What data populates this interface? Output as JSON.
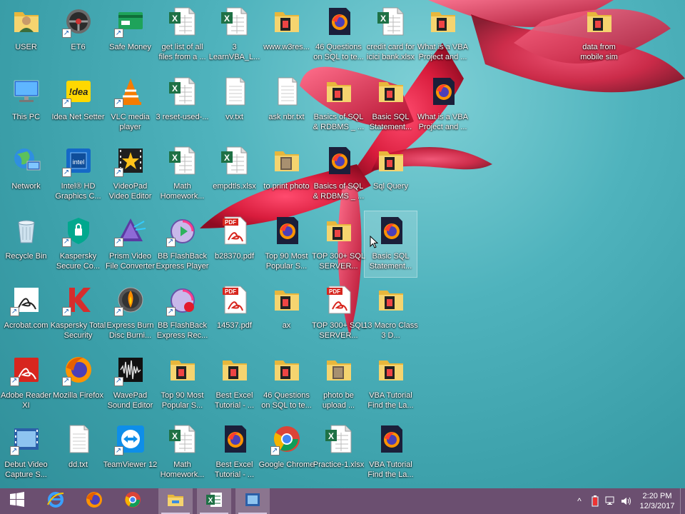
{
  "desktop": {
    "icons": [
      {
        "label": "USER",
        "type": "user",
        "shortcut": false,
        "col": 0,
        "row": 0
      },
      {
        "label": "This PC",
        "type": "pc",
        "shortcut": false,
        "col": 0,
        "row": 1
      },
      {
        "label": "Network",
        "type": "network",
        "shortcut": false,
        "col": 0,
        "row": 2
      },
      {
        "label": "Recycle Bin",
        "type": "recycle",
        "shortcut": false,
        "col": 0,
        "row": 3
      },
      {
        "label": "Acrobat.com",
        "type": "acrobat",
        "shortcut": true,
        "col": 0,
        "row": 4
      },
      {
        "label": "Adobe Reader XI",
        "type": "adobe",
        "shortcut": true,
        "col": 0,
        "row": 5
      },
      {
        "label": "Debut Video Capture S...",
        "type": "video",
        "shortcut": true,
        "col": 0,
        "row": 6
      },
      {
        "label": "ET6",
        "type": "et6",
        "shortcut": true,
        "col": 1,
        "row": 0
      },
      {
        "label": "Idea Net Setter",
        "type": "idea",
        "shortcut": true,
        "col": 1,
        "row": 1
      },
      {
        "label": "Intel® HD Graphics C...",
        "type": "intel",
        "shortcut": true,
        "col": 1,
        "row": 2
      },
      {
        "label": "Kaspersky Secure Co...",
        "type": "kaspersky-shield",
        "shortcut": true,
        "col": 1,
        "row": 3
      },
      {
        "label": "Kaspersky Total Security",
        "type": "kaspersky",
        "shortcut": true,
        "col": 1,
        "row": 4
      },
      {
        "label": "Mozilla Firefox",
        "type": "firefox",
        "shortcut": true,
        "col": 1,
        "row": 5
      },
      {
        "label": "dd.txt",
        "type": "txt",
        "shortcut": false,
        "col": 1,
        "row": 6
      },
      {
        "label": "Safe Money",
        "type": "safemoney",
        "shortcut": true,
        "col": 2,
        "row": 0
      },
      {
        "label": "VLC media player",
        "type": "vlc",
        "shortcut": true,
        "col": 2,
        "row": 1
      },
      {
        "label": "VideoPad Video Editor",
        "type": "videopad",
        "shortcut": true,
        "col": 2,
        "row": 2
      },
      {
        "label": "Prism Video File Converter",
        "type": "prism",
        "shortcut": true,
        "col": 2,
        "row": 3
      },
      {
        "label": "Express Burn Disc Burni...",
        "type": "burn",
        "shortcut": true,
        "col": 2,
        "row": 4
      },
      {
        "label": "WavePad Sound Editor",
        "type": "wavepad",
        "shortcut": true,
        "col": 2,
        "row": 5
      },
      {
        "label": "TeamViewer 12",
        "type": "teamviewer",
        "shortcut": true,
        "col": 2,
        "row": 6
      },
      {
        "label": "get list of all files from a ...",
        "type": "excel",
        "shortcut": false,
        "col": 3,
        "row": 0
      },
      {
        "label": "3 reset-used-...",
        "type": "excel",
        "shortcut": false,
        "col": 3,
        "row": 1
      },
      {
        "label": "Math Homework...",
        "type": "excel",
        "shortcut": false,
        "col": 3,
        "row": 2
      },
      {
        "label": "BB FlashBack Express Player",
        "type": "flashback",
        "shortcut": true,
        "col": 3,
        "row": 3
      },
      {
        "label": "BB FlashBack Express Rec...",
        "type": "flashback-rec",
        "shortcut": true,
        "col": 3,
        "row": 4
      },
      {
        "label": "Top 90 Most Popular S...",
        "type": "folder",
        "shortcut": false,
        "col": 3,
        "row": 5
      },
      {
        "label": "Math Homework...",
        "type": "excel",
        "shortcut": false,
        "col": 3,
        "row": 6
      },
      {
        "label": "3 LearnVBA_L...",
        "type": "excel",
        "shortcut": false,
        "col": 4,
        "row": 0
      },
      {
        "label": "vv.txt",
        "type": "txt",
        "shortcut": false,
        "col": 4,
        "row": 1
      },
      {
        "label": "empdtls.xlsx",
        "type": "excel",
        "shortcut": false,
        "col": 4,
        "row": 2
      },
      {
        "label": "b28370.pdf",
        "type": "pdf",
        "shortcut": false,
        "col": 4,
        "row": 3
      },
      {
        "label": "14537.pdf",
        "type": "pdf",
        "shortcut": false,
        "col": 4,
        "row": 4
      },
      {
        "label": "Best Excel Tutorial - ...",
        "type": "folder",
        "shortcut": false,
        "col": 4,
        "row": 5
      },
      {
        "label": "Best Excel Tutorial - ...",
        "type": "firefox-doc",
        "shortcut": false,
        "col": 4,
        "row": 6
      },
      {
        "label": "www.w3res...",
        "type": "folder",
        "shortcut": false,
        "col": 5,
        "row": 0
      },
      {
        "label": "ask nbr.txt",
        "type": "txt",
        "shortcut": false,
        "col": 5,
        "row": 1
      },
      {
        "label": "to print photo",
        "type": "folder-photo",
        "shortcut": false,
        "col": 5,
        "row": 2
      },
      {
        "label": "Top 90 Most Popular S...",
        "type": "firefox-doc",
        "shortcut": false,
        "col": 5,
        "row": 3
      },
      {
        "label": "ax",
        "type": "folder",
        "shortcut": false,
        "col": 5,
        "row": 4
      },
      {
        "label": "46 Questions on SQL to te...",
        "type": "folder",
        "shortcut": false,
        "col": 5,
        "row": 5
      },
      {
        "label": "Google Chrome",
        "type": "chrome",
        "shortcut": true,
        "col": 5,
        "row": 6
      },
      {
        "label": "46 Questions on SQL to te...",
        "type": "firefox-doc",
        "shortcut": false,
        "col": 6,
        "row": 0
      },
      {
        "label": "Basics of SQL & RDBMS _ ...",
        "type": "folder",
        "shortcut": false,
        "col": 6,
        "row": 1
      },
      {
        "label": "Basics of SQL & RDBMS _ ...",
        "type": "firefox-doc",
        "shortcut": false,
        "col": 6,
        "row": 2
      },
      {
        "label": "TOP 300+ SQL SERVER...",
        "type": "folder",
        "shortcut": false,
        "col": 6,
        "row": 3
      },
      {
        "label": "TOP 300+ SQL SERVER...",
        "type": "pdf",
        "shortcut": false,
        "col": 6,
        "row": 4
      },
      {
        "label": "photo be upload ...",
        "type": "folder-photo",
        "shortcut": false,
        "col": 6,
        "row": 5
      },
      {
        "label": "Practice-1.xlsx",
        "type": "excel",
        "shortcut": false,
        "col": 6,
        "row": 6
      },
      {
        "label": "credit card for icici bank.xlsx",
        "type": "excel",
        "shortcut": false,
        "col": 7,
        "row": 0
      },
      {
        "label": "Basic SQL Statement...",
        "type": "folder",
        "shortcut": false,
        "col": 7,
        "row": 1
      },
      {
        "label": "Sql Query",
        "type": "folder",
        "shortcut": false,
        "col": 7,
        "row": 2
      },
      {
        "label": "Basic SQL Statement...",
        "type": "firefox-doc",
        "shortcut": false,
        "col": 7,
        "row": 3,
        "selected": true
      },
      {
        "label": "13 Macro Class 3 D...",
        "type": "folder",
        "shortcut": false,
        "col": 7,
        "row": 4
      },
      {
        "label": "VBA Tutorial Find the La...",
        "type": "folder",
        "shortcut": false,
        "col": 7,
        "row": 5
      },
      {
        "label": "VBA Tutorial Find the La...",
        "type": "firefox-doc",
        "shortcut": false,
        "col": 7,
        "row": 6
      },
      {
        "label": "What is a VBA Project and ...",
        "type": "folder",
        "shortcut": false,
        "col": 8,
        "row": 0
      },
      {
        "label": "What is a VBA Project and ...",
        "type": "firefox-doc",
        "shortcut": false,
        "col": 8,
        "row": 1
      },
      {
        "label": "data from mobile sim",
        "type": "folder",
        "shortcut": false,
        "col": 11,
        "row": 0
      }
    ]
  },
  "taskbar": {
    "buttons": [
      {
        "name": "start-button",
        "icon": "windows-icon",
        "active": false
      },
      {
        "name": "taskbar-ie",
        "icon": "ie-icon",
        "active": false
      },
      {
        "name": "taskbar-firefox",
        "icon": "firefox-icon",
        "active": false
      },
      {
        "name": "taskbar-chrome",
        "icon": "chrome-icon",
        "active": false
      },
      {
        "name": "taskbar-explorer",
        "icon": "file-explorer-icon",
        "active": true
      },
      {
        "name": "taskbar-excel",
        "icon": "excel-icon",
        "active": true
      },
      {
        "name": "taskbar-debut",
        "icon": "video-capture-icon",
        "active": true
      }
    ],
    "clock": {
      "time": "2:20 PM",
      "date": "12/3/2017"
    }
  },
  "colors": {
    "taskbar": "#6b4f70",
    "excel": "#1e7145",
    "pdf_red": "#d7261e",
    "folder": "#f3cc62"
  }
}
